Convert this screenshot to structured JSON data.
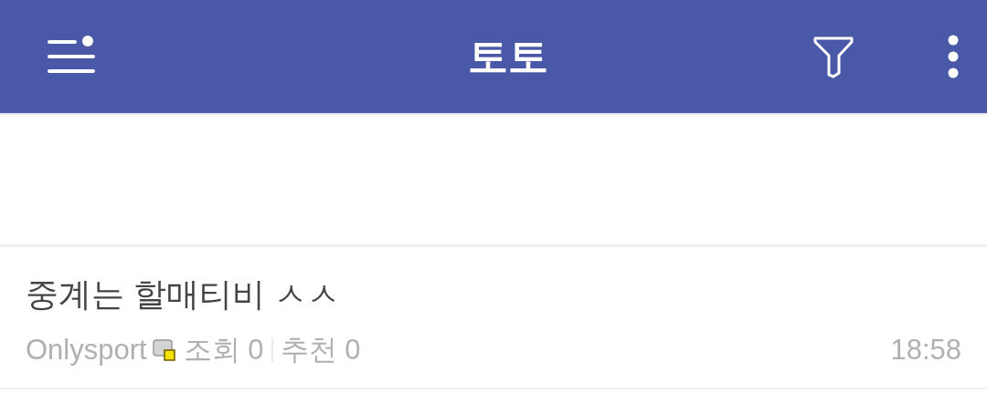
{
  "app_bar": {
    "title": "토토"
  },
  "posts": [
    {
      "title": "중계는 할매티비 ㅅㅅ",
      "author": "Onlysport",
      "views": "조회 0",
      "recommends": "추천 0",
      "time": "18:58"
    }
  ]
}
